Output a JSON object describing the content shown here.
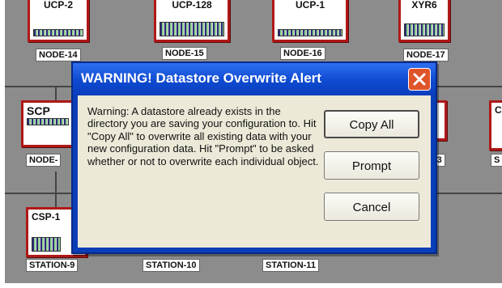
{
  "dialog": {
    "title": "WARNING!  Datastore Overwrite Alert",
    "close_icon": "close-icon",
    "message": "Warning:  A datastore already exists in the directory you are saving your configuration to.  Hit \"Copy All\" to overwrite all existing data with your new configuration data.  Hit \"Prompt\" to be asked whether or not to overwrite each individual object.",
    "buttons": {
      "copy_all": "Copy All",
      "prompt": "Prompt",
      "cancel": "Cancel"
    }
  },
  "network": {
    "top_row": [
      {
        "type": "UCP-2",
        "label": "NODE-14"
      },
      {
        "type": "UCP-128",
        "label": "NODE-15"
      },
      {
        "type": "UCP-1",
        "label": "NODE-16"
      },
      {
        "type": "XYR6",
        "label": "NODE-17"
      }
    ],
    "middle_row": [
      {
        "type": "SCP",
        "label": "NODE-"
      },
      {
        "type": "",
        "label": "-3"
      },
      {
        "type": "C",
        "label": "S"
      }
    ],
    "bottom_row": [
      {
        "type": "CSP-1",
        "label": "STATION-9"
      },
      {
        "type": "",
        "label": "STATION-10"
      },
      {
        "type": "",
        "label": "STATION-11"
      }
    ]
  },
  "colors": {
    "canvas_bg": "#8c8c8c",
    "node_border": "#b01818",
    "title_bar": "#0e4ad0",
    "close_button": "#e0542a",
    "dialog_body": "#ece9d8"
  }
}
